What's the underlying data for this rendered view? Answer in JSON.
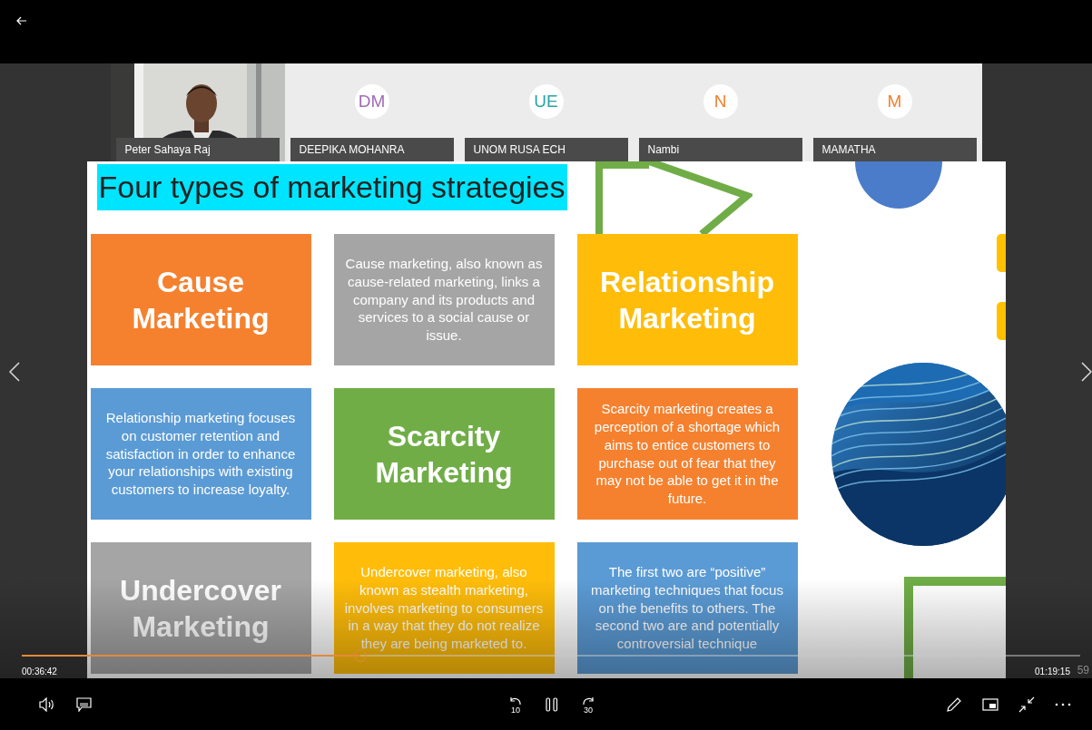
{
  "participants": [
    {
      "kind": "video",
      "name": "Peter Sahaya Raj"
    },
    {
      "kind": "avatar",
      "name": "DEEPIKA MOHANRA",
      "initials": "DM",
      "color": "#a06cb4"
    },
    {
      "kind": "avatar",
      "name": "UNOM RUSA ECH",
      "initials": "UE",
      "color": "#2ba3a3"
    },
    {
      "kind": "avatar",
      "name": "Nambi",
      "initials": "N",
      "color": "#f0812f"
    },
    {
      "kind": "avatar",
      "name": "MAMATHA",
      "initials": "M",
      "color": "#f0812f"
    }
  ],
  "slide": {
    "title": "Four types of marketing strategies",
    "tiles": [
      {
        "kind": "heading",
        "text": "Cause Marketing",
        "color": "#f5812f"
      },
      {
        "kind": "body",
        "text": "Cause marketing, also known as cause-related marketing, links a company and its products and services to a social cause or issue.",
        "color": "#a5a5a5"
      },
      {
        "kind": "heading",
        "text": "Relationship Marketing",
        "color": "#ffbd0a"
      },
      {
        "kind": "body",
        "text": "Relationship marketing focuses on customer retention and satisfaction in order to enhance your relationships with existing customers to increase loyalty.",
        "color": "#5b9bd5"
      },
      {
        "kind": "heading",
        "text": "Scarcity Marketing",
        "color": "#70ad47"
      },
      {
        "kind": "body",
        "text": "Scarcity marketing creates a perception of a shortage which aims to entice customers to purchase out of fear that they may not be able to get it in the future.",
        "color": "#f5812f"
      },
      {
        "kind": "heading",
        "text": "Undercover Marketing",
        "color": "#a5a5a5"
      },
      {
        "kind": "body",
        "text": "Undercover marketing, also known as stealth marketing, involves marketing to consumers in a way that they do not realize they are being marketed to.",
        "color": "#ffbd0a"
      },
      {
        "kind": "body",
        "text": "The first two are “positive” marketing techniques that focus on the benefits to others. The second two are and potentially controversial technique",
        "color": "#5b9bd5"
      }
    ]
  },
  "player": {
    "elapsed": "00:36:42",
    "duration": "01:19:15",
    "duration_overlap": "59",
    "progress": {
      "level": 0.32
    },
    "skip_back": "10",
    "skip_forward": "30"
  }
}
